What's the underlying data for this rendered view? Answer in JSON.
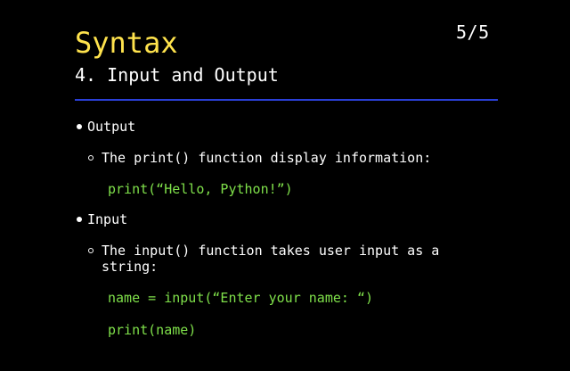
{
  "slide": {
    "title": "Syntax",
    "subtitle": "4. Input and Output",
    "page_counter": "5/5",
    "colors": {
      "background": "#000000",
      "title": "#ffe34d",
      "divider": "#2a3fd6",
      "code": "#7fe04a",
      "text": "#ffffff"
    }
  },
  "content": {
    "sections": [
      {
        "heading": "Output",
        "points": [
          {
            "text_line1": "The print() function display information:",
            "code": [
              "print(“Hello, Python!”)"
            ]
          }
        ]
      },
      {
        "heading": "Input",
        "points": [
          {
            "text_line1": "The input() function takes user input as a",
            "text_line2": "string:",
            "code": [
              "name = input(“Enter your name: “)",
              "print(name)"
            ]
          }
        ]
      }
    ]
  }
}
